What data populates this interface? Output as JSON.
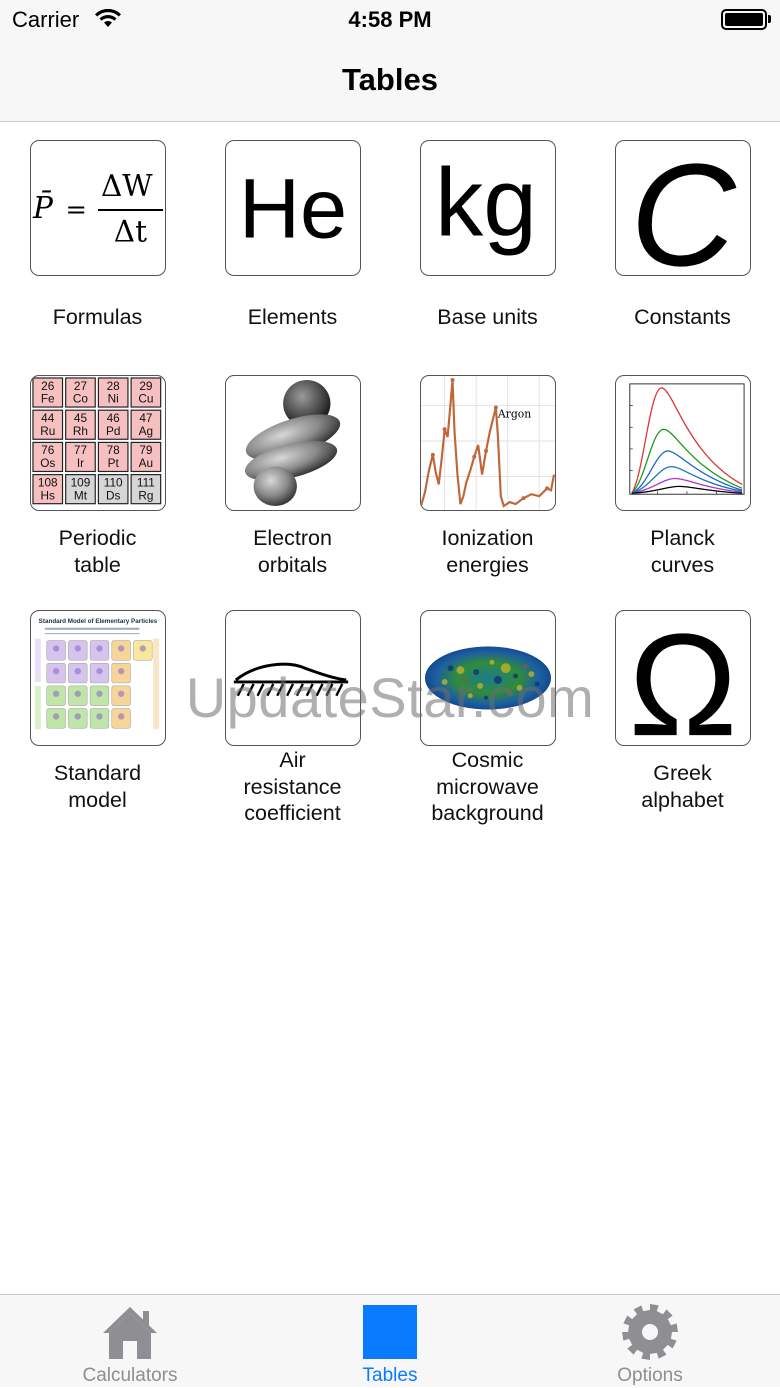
{
  "status_bar": {
    "carrier": "Carrier",
    "time": "4:58 PM"
  },
  "nav": {
    "title": "Tables"
  },
  "grid": [
    {
      "label": "Formulas"
    },
    {
      "label": "Elements"
    },
    {
      "label": "Base units"
    },
    {
      "label": "Constants"
    },
    {
      "label": "Periodic\ntable"
    },
    {
      "label": "Electron\norbitals"
    },
    {
      "label": "Ionization\nenergies"
    },
    {
      "label": "Planck\ncurves"
    },
    {
      "label": "Standard\nmodel"
    },
    {
      "label": "Air\nresistance\ncoefficient"
    },
    {
      "label": "Cosmic\nmicrowave\nbackground"
    },
    {
      "label": "Greek\nalphabet"
    }
  ],
  "tile_text": {
    "formula_p": "P̄",
    "formula_eq": "=",
    "formula_num": "ΔW",
    "formula_den": "Δt",
    "elements": "He",
    "base_units": "kg",
    "constants": "C",
    "ionization_label": "Argon",
    "standard_model_title": "Standard Model of Elementary Particles",
    "greek": "Ω"
  },
  "periodic_cells": [
    [
      "26",
      "Fe"
    ],
    [
      "27",
      "Co"
    ],
    [
      "28",
      "Ni"
    ],
    [
      "29",
      "Cu"
    ],
    [
      "44",
      "Ru"
    ],
    [
      "45",
      "Rh"
    ],
    [
      "46",
      "Pd"
    ],
    [
      "47",
      "Ag"
    ],
    [
      "76",
      "Os"
    ],
    [
      "77",
      "Ir"
    ],
    [
      "78",
      "Pt"
    ],
    [
      "79",
      "Au"
    ],
    [
      "108",
      "Hs"
    ],
    [
      "109",
      "Mt"
    ],
    [
      "110",
      "Ds"
    ],
    [
      "111",
      "Rg"
    ]
  ],
  "watermark": "UpdateStar.com",
  "tabs": [
    {
      "label": "Calculators",
      "icon": "house-icon",
      "selected": false
    },
    {
      "label": "Tables",
      "icon": "square-icon",
      "selected": true
    },
    {
      "label": "Options",
      "icon": "gear-icon",
      "selected": false
    }
  ],
  "colors": {
    "accent": "#0a7aff",
    "tab_inactive": "#8e8e93",
    "bar_bg": "#f7f7f7"
  }
}
